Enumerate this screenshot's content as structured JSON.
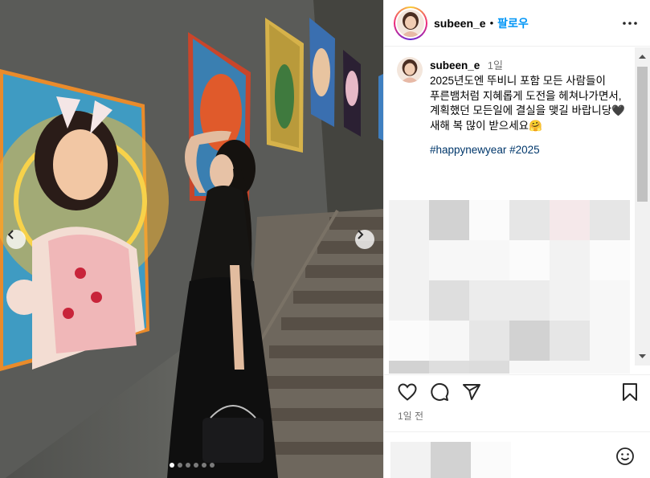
{
  "post": {
    "image": {
      "alt": "",
      "carousel_count": 6,
      "carousel_active_index": 0
    },
    "author": {
      "username": "subeen_e",
      "separator": "•",
      "follow_label": "팔로우"
    },
    "caption": {
      "username": "subeen_e",
      "time": "1일",
      "text": "2025년도엔 뚜비니 포함 모든 사람들이\n푸른뱀처럼 지혜롭게 도전을 헤쳐나가면서, 계획했던 모든일에 결실을 맺길 바랍니당🖤\n새해 복 많이 받으세요🤗",
      "hashtags": [
        "#happynewyear",
        "#2025"
      ]
    },
    "date_label": "1일 전"
  },
  "colors": {
    "follow_blue": "#0095f6",
    "hashtag_blue": "#00376b",
    "secondary_text": "#737373",
    "divider": "#efefef"
  },
  "icons": {
    "more": "more-horizontal-icon",
    "like": "heart-icon",
    "comment": "comment-bubble-icon",
    "share": "paper-plane-icon",
    "save": "bookmark-icon",
    "emoji": "smiley-icon",
    "prev": "chevron-left-icon",
    "next": "chevron-right-icon"
  }
}
